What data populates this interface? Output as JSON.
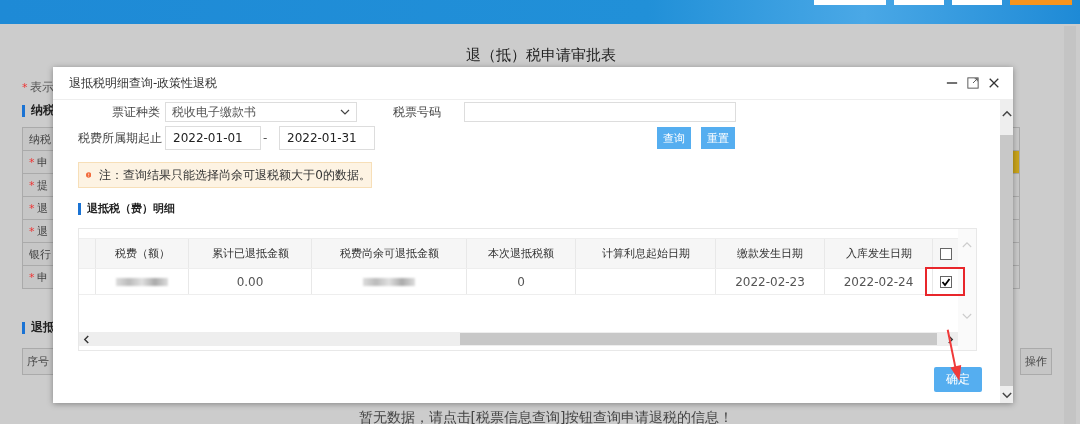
{
  "page": {
    "title": "退（抵）税申请审批表",
    "required_mark": "*",
    "required_note": "表示",
    "section_1": "纳税",
    "rows": [
      {
        "label": "纳税",
        "required": false,
        "kind": "text"
      },
      {
        "label": "申",
        "required": true,
        "kind": "highlight"
      },
      {
        "label": "提",
        "required": true,
        "kind": "text"
      },
      {
        "label": "退",
        "required": true,
        "kind": "select"
      },
      {
        "label": "退",
        "required": true,
        "kind": "select"
      },
      {
        "label": "银行",
        "required": false,
        "kind": "text"
      },
      {
        "label": "申",
        "required": true,
        "kind": "text"
      }
    ],
    "section_2": "退抵",
    "list_first_column": "序号",
    "list_last_column": "操作",
    "empty_message": "暂无数据，请点击[税票信息查询]按钮查询申请退税的信息！"
  },
  "dialog": {
    "title": "退抵税明细查询-政策性退税",
    "form": {
      "ticket_type_label": "票证种类",
      "ticket_type_value": "税收电子缴款书",
      "ticket_number_label": "税票号码",
      "period_label": "税费所属期起止",
      "period_from": "2022-01-01",
      "period_separator": "-",
      "period_to": "2022-01-31",
      "buttons": [
        "查询",
        "重置"
      ]
    },
    "notice": "注：查询结果只能选择尚余可退税额大于0的数据。",
    "section_title": "退抵税（费）明细",
    "table": {
      "columns": [
        "税费（额）",
        "累计已退抵金额",
        "税费尚余可退抵金额",
        "本次退抵税额",
        "计算利息起始日期",
        "缴款发生日期",
        "入库发生日期"
      ],
      "header_checked": false,
      "rows": [
        {
          "checked": true,
          "cells": [
            {
              "kind": "blurred"
            },
            {
              "kind": "text",
              "text": "0.00"
            },
            {
              "kind": "blurred"
            },
            {
              "kind": "text",
              "text": "0"
            },
            {
              "kind": "empty"
            },
            {
              "kind": "text",
              "text": "2022-02-23"
            },
            {
              "kind": "text",
              "text": "2022-02-24"
            }
          ]
        }
      ]
    },
    "confirm_button": "确定"
  }
}
